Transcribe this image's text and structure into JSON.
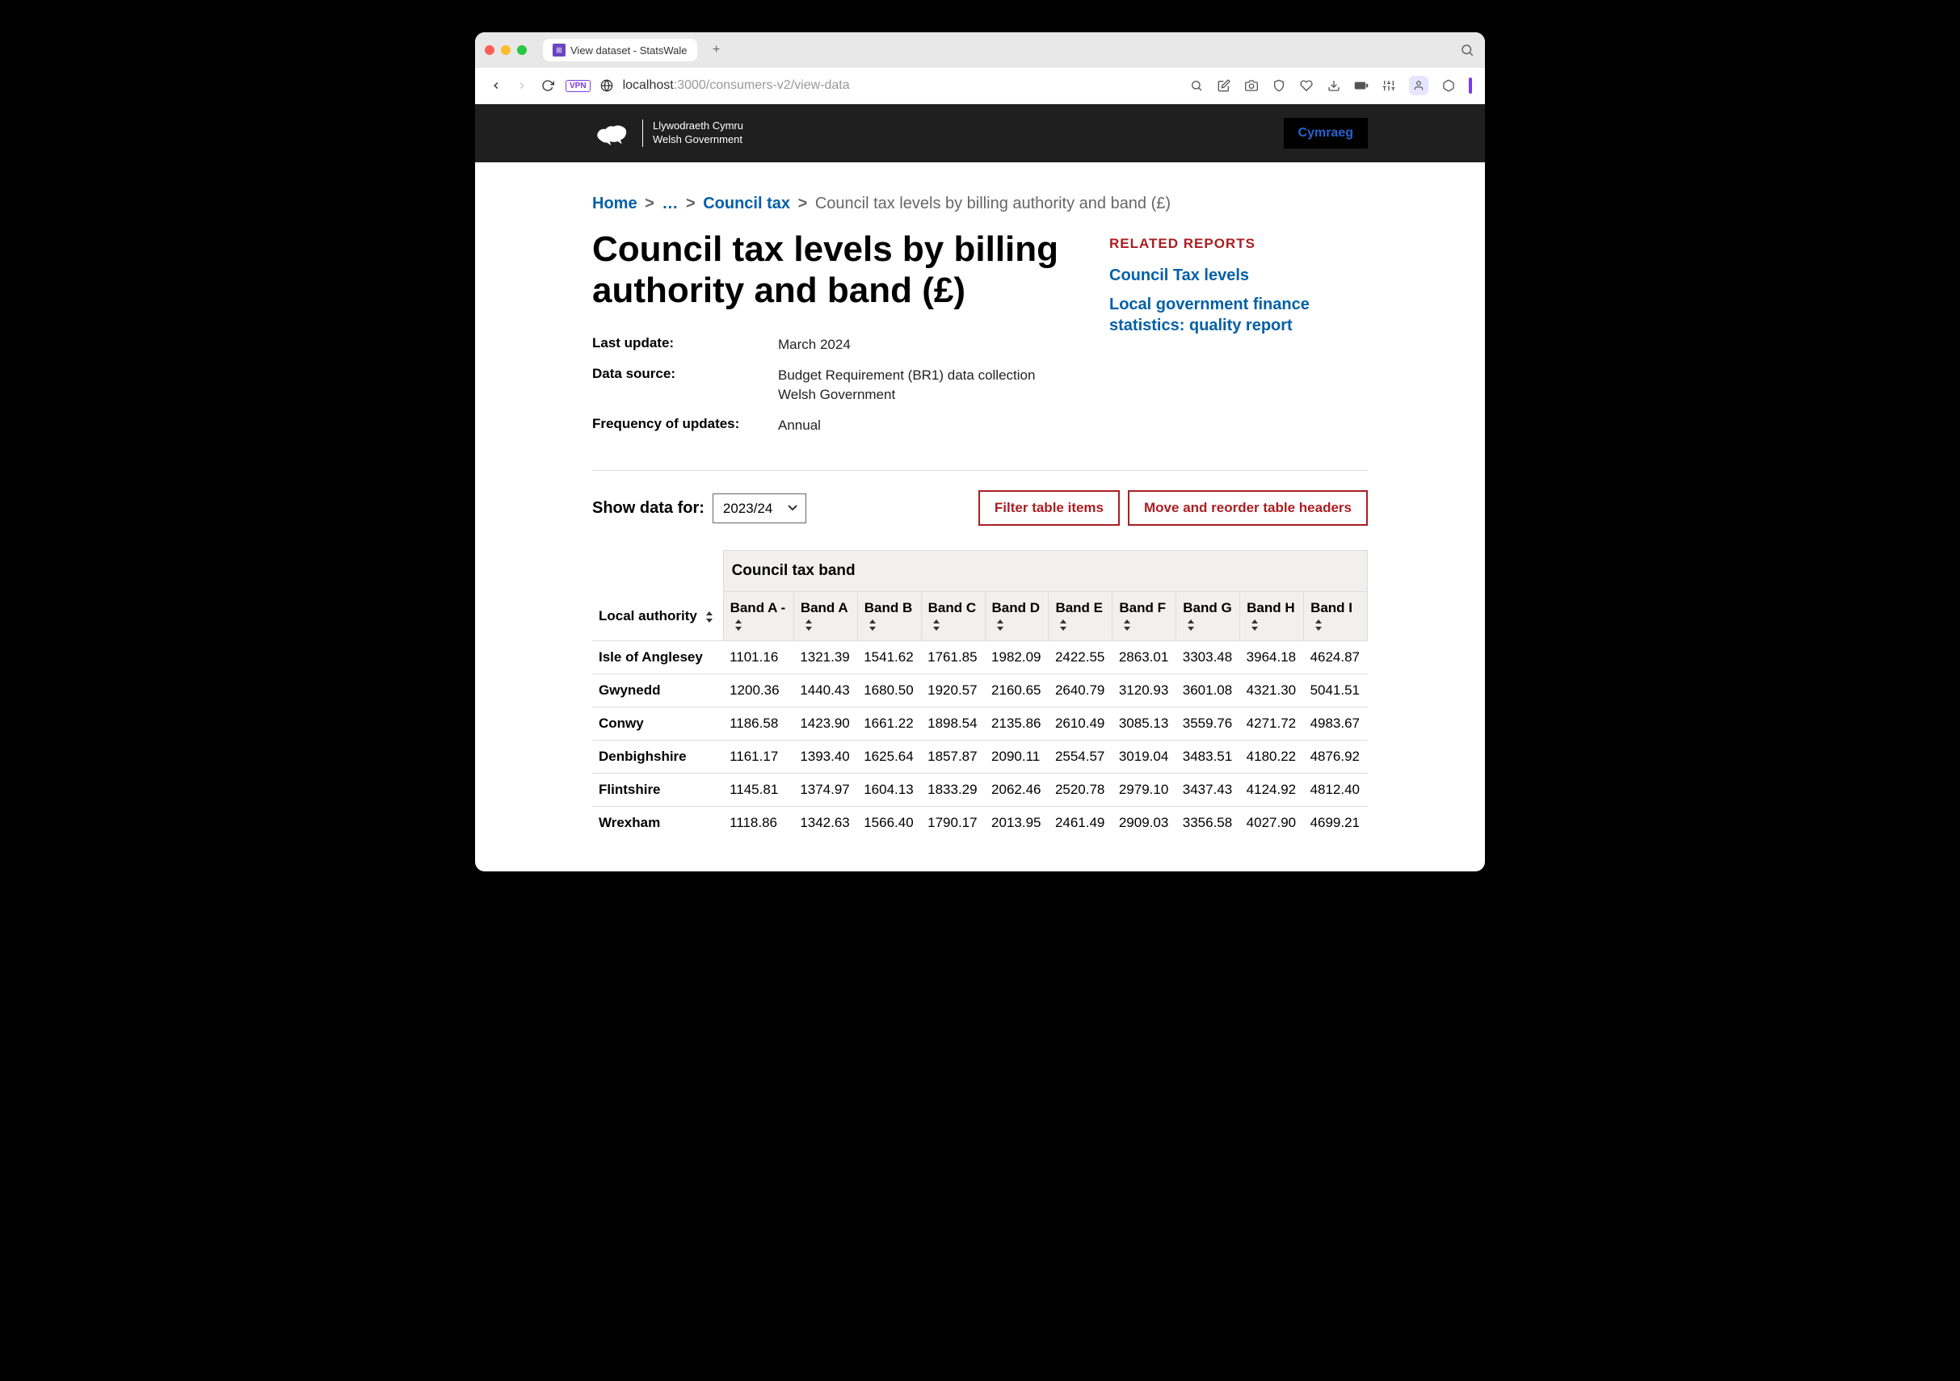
{
  "browser": {
    "tab_title": "View dataset - StatsWale",
    "url_host": "localhost",
    "url_port": ":3000",
    "url_path": "/consumers-v2/view-data",
    "vpn_label": "VPN"
  },
  "gov_header": {
    "logo_top": "Llywodraeth Cymru",
    "logo_bottom": "Welsh Government",
    "lang_button": "Cymraeg"
  },
  "breadcrumb": {
    "home": "Home",
    "ellipsis": "…",
    "parent": "Council tax",
    "current": "Council tax levels by billing authority and band (£)"
  },
  "page": {
    "title": "Council tax levels by billing authority and band (£)",
    "meta": [
      {
        "label": "Last update:",
        "value": "March 2024"
      },
      {
        "label": "Data source:",
        "value": "Budget Requirement (BR1) data collection Welsh Government"
      },
      {
        "label": "Frequency of updates:",
        "value": "Annual"
      }
    ]
  },
  "related": {
    "heading": "RELATED REPORTS",
    "links": [
      "Council Tax levels",
      "Local government finance statistics: quality report"
    ]
  },
  "controls": {
    "label": "Show data for:",
    "selected_year": "2023/24",
    "filter_button": "Filter table items",
    "reorder_button": "Move and reorder table headers"
  },
  "table": {
    "row_header_col": "Local authority",
    "col_group": "Council tax band",
    "columns": [
      "Band A -",
      "Band A",
      "Band B",
      "Band C",
      "Band D",
      "Band E",
      "Band F",
      "Band G",
      "Band H",
      "Band I"
    ],
    "rows": [
      {
        "name": "Isle of Anglesey",
        "values": [
          "1101.16",
          "1321.39",
          "1541.62",
          "1761.85",
          "1982.09",
          "2422.55",
          "2863.01",
          "3303.48",
          "3964.18",
          "4624.87"
        ]
      },
      {
        "name": "Gwynedd",
        "values": [
          "1200.36",
          "1440.43",
          "1680.50",
          "1920.57",
          "2160.65",
          "2640.79",
          "3120.93",
          "3601.08",
          "4321.30",
          "5041.51"
        ]
      },
      {
        "name": "Conwy",
        "values": [
          "1186.58",
          "1423.90",
          "1661.22",
          "1898.54",
          "2135.86",
          "2610.49",
          "3085.13",
          "3559.76",
          "4271.72",
          "4983.67"
        ]
      },
      {
        "name": "Denbighshire",
        "values": [
          "1161.17",
          "1393.40",
          "1625.64",
          "1857.87",
          "2090.11",
          "2554.57",
          "3019.04",
          "3483.51",
          "4180.22",
          "4876.92"
        ]
      },
      {
        "name": "Flintshire",
        "values": [
          "1145.81",
          "1374.97",
          "1604.13",
          "1833.29",
          "2062.46",
          "2520.78",
          "2979.10",
          "3437.43",
          "4124.92",
          "4812.40"
        ]
      },
      {
        "name": "Wrexham",
        "values": [
          "1118.86",
          "1342.63",
          "1566.40",
          "1790.17",
          "2013.95",
          "2461.49",
          "2909.03",
          "3356.58",
          "4027.90",
          "4699.21"
        ]
      }
    ]
  },
  "chart_data": {
    "type": "table",
    "title": "Council tax levels by billing authority and band (£)",
    "year": "2023/24",
    "categories": [
      "Band A -",
      "Band A",
      "Band B",
      "Band C",
      "Band D",
      "Band E",
      "Band F",
      "Band G",
      "Band H",
      "Band I"
    ],
    "series": [
      {
        "name": "Isle of Anglesey",
        "values": [
          1101.16,
          1321.39,
          1541.62,
          1761.85,
          1982.09,
          2422.55,
          2863.01,
          3303.48,
          3964.18,
          4624.87
        ]
      },
      {
        "name": "Gwynedd",
        "values": [
          1200.36,
          1440.43,
          1680.5,
          1920.57,
          2160.65,
          2640.79,
          3120.93,
          3601.08,
          4321.3,
          5041.51
        ]
      },
      {
        "name": "Conwy",
        "values": [
          1186.58,
          1423.9,
          1661.22,
          1898.54,
          2135.86,
          2610.49,
          3085.13,
          3559.76,
          4271.72,
          4983.67
        ]
      },
      {
        "name": "Denbighshire",
        "values": [
          1161.17,
          1393.4,
          1625.64,
          1857.87,
          2090.11,
          2554.57,
          3019.04,
          3483.51,
          4180.22,
          4876.92
        ]
      },
      {
        "name": "Flintshire",
        "values": [
          1145.81,
          1374.97,
          1604.13,
          1833.29,
          2062.46,
          2520.78,
          2979.1,
          3437.43,
          4124.92,
          4812.4
        ]
      },
      {
        "name": "Wrexham",
        "values": [
          1118.86,
          1342.63,
          1566.4,
          1790.17,
          2013.95,
          2461.49,
          2909.03,
          3356.58,
          4027.9,
          4699.21
        ]
      }
    ]
  }
}
